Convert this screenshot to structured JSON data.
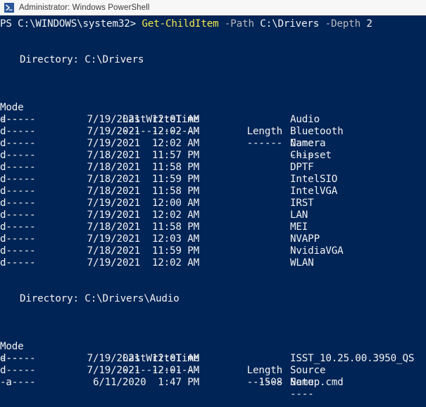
{
  "window": {
    "title": "Administrator: Windows PowerShell",
    "icon": "powershell-icon",
    "titlebar_bg": "#f7f7f7",
    "console_bg": "#012456",
    "text_color": "#f2f2f2",
    "accent_yellow": "#f2e84c",
    "param_gray": "#b9b9bd"
  },
  "prompt": {
    "prefix": "PS C:\\WINDOWS\\system32> ",
    "command": "Get-ChildItem",
    "param1": "-Path",
    "value1": "C:\\Drivers",
    "param2": "-Depth",
    "value2": "2"
  },
  "columns": {
    "mode": "Mode",
    "lastwritetime": "LastWriteTime",
    "length": "Length",
    "name": "Name",
    "rule_mode": "----",
    "rule_lastwritetime": "-------------",
    "rule_length": "------",
    "rule_name": "----"
  },
  "sections": [
    {
      "directory_label": "Directory: C:\\Drivers",
      "rows": [
        {
          "mode": "d-----",
          "date": "7/19/2021",
          "time": "12:01 AM",
          "length": "",
          "name": "Audio"
        },
        {
          "mode": "d-----",
          "date": "7/19/2021",
          "time": "12:02 AM",
          "length": "",
          "name": "Bluetooth"
        },
        {
          "mode": "d-----",
          "date": "7/19/2021",
          "time": "12:02 AM",
          "length": "",
          "name": "Camera"
        },
        {
          "mode": "d-----",
          "date": "7/18/2021",
          "time": "11:57 PM",
          "length": "",
          "name": "Chipset"
        },
        {
          "mode": "d-----",
          "date": "7/18/2021",
          "time": "11:58 PM",
          "length": "",
          "name": "DPTF"
        },
        {
          "mode": "d-----",
          "date": "7/18/2021",
          "time": "11:59 PM",
          "length": "",
          "name": "IntelSIO"
        },
        {
          "mode": "d-----",
          "date": "7/18/2021",
          "time": "11:58 PM",
          "length": "",
          "name": "IntelVGA"
        },
        {
          "mode": "d-----",
          "date": "7/19/2021",
          "time": "12:00 AM",
          "length": "",
          "name": "IRST"
        },
        {
          "mode": "d-----",
          "date": "7/19/2021",
          "time": "12:02 AM",
          "length": "",
          "name": "LAN"
        },
        {
          "mode": "d-----",
          "date": "7/18/2021",
          "time": "11:58 PM",
          "length": "",
          "name": "MEI"
        },
        {
          "mode": "d-----",
          "date": "7/19/2021",
          "time": "12:03 AM",
          "length": "",
          "name": "NVAPP"
        },
        {
          "mode": "d-----",
          "date": "7/18/2021",
          "time": "11:59 PM",
          "length": "",
          "name": "NvidiaVGA"
        },
        {
          "mode": "d-----",
          "date": "7/19/2021",
          "time": "12:02 AM",
          "length": "",
          "name": "WLAN"
        }
      ]
    },
    {
      "directory_label": "Directory: C:\\Drivers\\Audio",
      "rows": [
        {
          "mode": "d-----",
          "date": "7/19/2021",
          "time": "12:01 AM",
          "length": "",
          "name": "ISST_10.25.00.3950_QS"
        },
        {
          "mode": "d-----",
          "date": "7/19/2021",
          "time": "12:01 AM",
          "length": "",
          "name": "Source"
        },
        {
          "mode": "-a----",
          "date": "6/11/2020",
          "time": "1:47 PM",
          "length": "1508",
          "name": "Setup.cmd"
        }
      ]
    }
  ]
}
